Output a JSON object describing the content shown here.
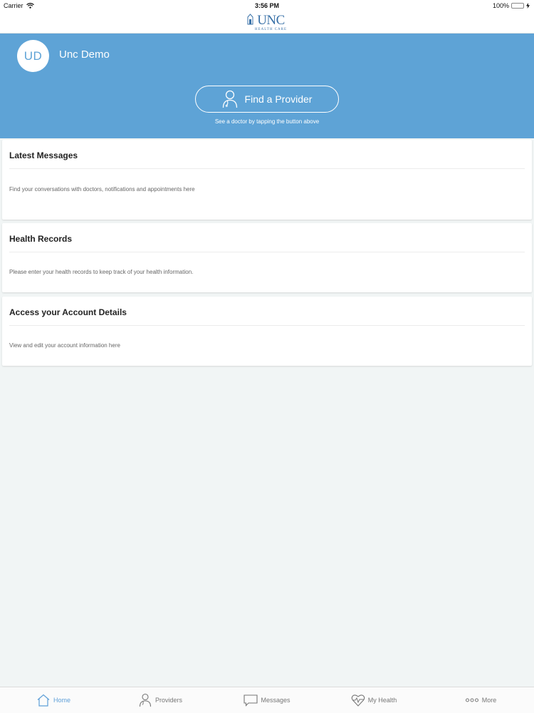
{
  "status_bar": {
    "carrier": "Carrier",
    "time": "3:56 PM",
    "battery": "100%",
    "battery_level": 1.0
  },
  "header": {
    "logo_main": "UNC",
    "logo_sub": "HEALTH CARE"
  },
  "profile": {
    "initials": "UD",
    "name": "Unc Demo"
  },
  "hero": {
    "button_label": "Find a Provider",
    "hint": "See a doctor by tapping the button above"
  },
  "cards": [
    {
      "title": "Latest Messages",
      "description": "Find your conversations with doctors, notifications and appointments here"
    },
    {
      "title": "Health Records",
      "description": "Please enter your health records to keep track of your health information."
    },
    {
      "title": "Access your Account Details",
      "description": "View and edit your account information here"
    }
  ],
  "tabs": [
    {
      "label": "Home",
      "icon": "home-icon",
      "active": true
    },
    {
      "label": "Providers",
      "icon": "person-icon",
      "active": false
    },
    {
      "label": "Messages",
      "icon": "message-icon",
      "active": false
    },
    {
      "label": "My Health",
      "icon": "heart-pulse-icon",
      "active": false
    },
    {
      "label": "More",
      "icon": "more-dots-icon",
      "active": false
    }
  ],
  "colors": {
    "hero_blue": "#5ea3d6",
    "active_tab": "#5e9fd8",
    "background": "#f1f5f5",
    "battery_green": "#4cd964"
  }
}
